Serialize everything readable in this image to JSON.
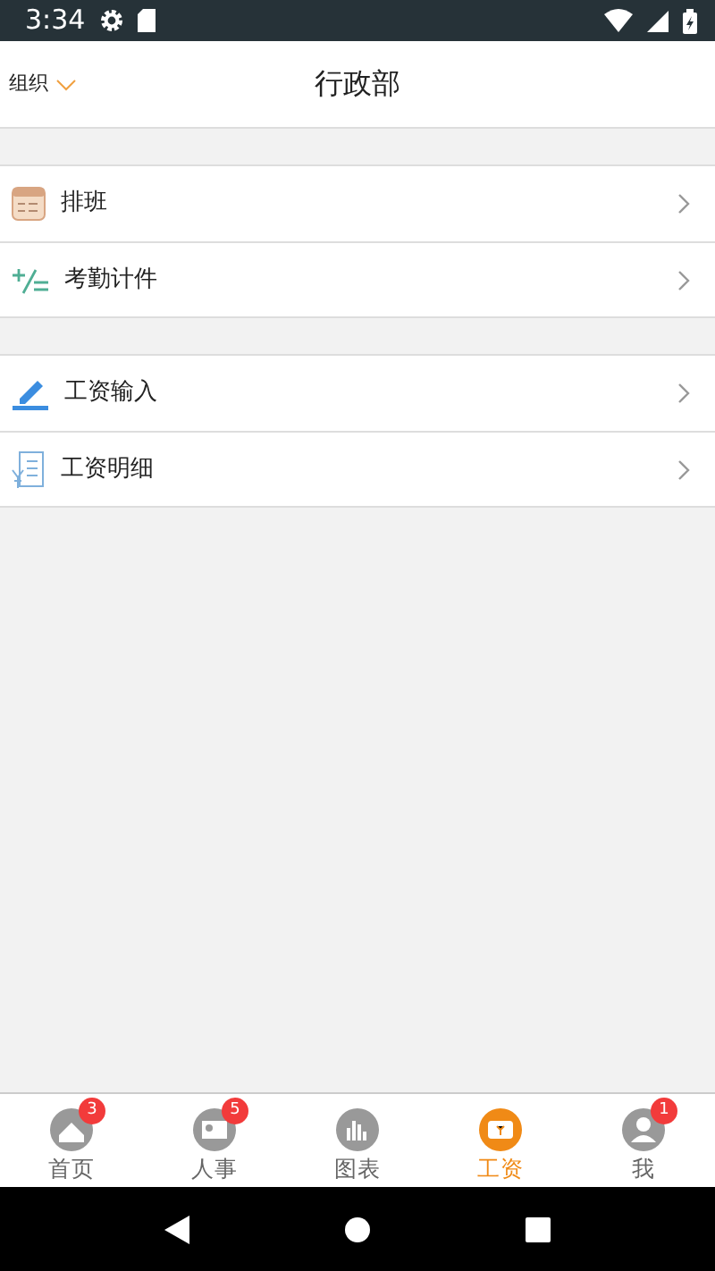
{
  "status_bar": {
    "time": "3:34"
  },
  "header": {
    "menu_label": "组织",
    "title": "行政部"
  },
  "groups": [
    [
      {
        "label": "排班"
      },
      {
        "label": "考勤计件"
      }
    ],
    [
      {
        "label": "工资输入"
      },
      {
        "label": "工资明细"
      }
    ]
  ],
  "tabs": [
    {
      "label": "首页",
      "selected": false,
      "badge": "3"
    },
    {
      "label": "人事",
      "selected": false,
      "badge": "5"
    },
    {
      "label": "图表",
      "selected": false
    },
    {
      "label": "工资",
      "selected": true
    },
    {
      "label": "我",
      "selected": false,
      "badge": "1"
    }
  ]
}
